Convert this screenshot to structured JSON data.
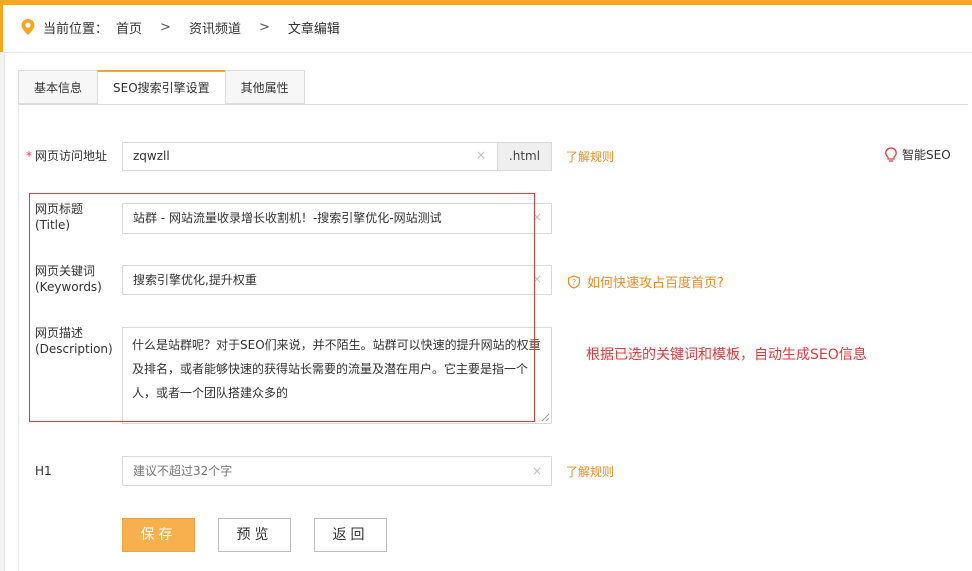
{
  "breadcrumb": {
    "prefix": "当前位置：",
    "items": [
      "首页",
      "资讯频道",
      "文章编辑"
    ],
    "separator": ">"
  },
  "tabs": [
    "基本信息",
    "SEO搜索引擎设置",
    "其他属性"
  ],
  "active_tab": 1,
  "form": {
    "url": {
      "label": "网页访问地址",
      "value": "zqwzll",
      "suffix": ".html",
      "help_link": "了解规则",
      "required_mark": "*"
    },
    "smart_seo": "智能SEO",
    "title": {
      "label": "网页标题",
      "sublabel": "(Title)",
      "value": "站群 - 网站流量收录增长收割机！-搜索引擎优化-网站测试"
    },
    "keywords": {
      "label": "网页关键词",
      "sublabel": "(Keywords)",
      "value": "搜索引擎优化,提升权重",
      "help_link": "如何快速攻占百度首页?"
    },
    "description": {
      "label": "网页描述",
      "sublabel": "(Description)",
      "value": "什么是站群呢？对于SEO们来说，并不陌生。站群可以快速的提升网站的权重及排名，或者能够快速的获得站长需要的流量及潜在用户。它主要是指一个人，或者一个团队搭建众多的"
    },
    "h1": {
      "label": "H1",
      "placeholder": "建议不超过32个字",
      "help_link": "了解规则"
    },
    "clear_glyph": "×"
  },
  "annotation": "根据已选的关键词和模板，自动生成SEO信息",
  "buttons": {
    "save": "保存",
    "preview": "预览",
    "back": "返回"
  },
  "colors": {
    "accent": "#f5a623",
    "link": "#f08a24",
    "annotation": "#e4393c"
  }
}
